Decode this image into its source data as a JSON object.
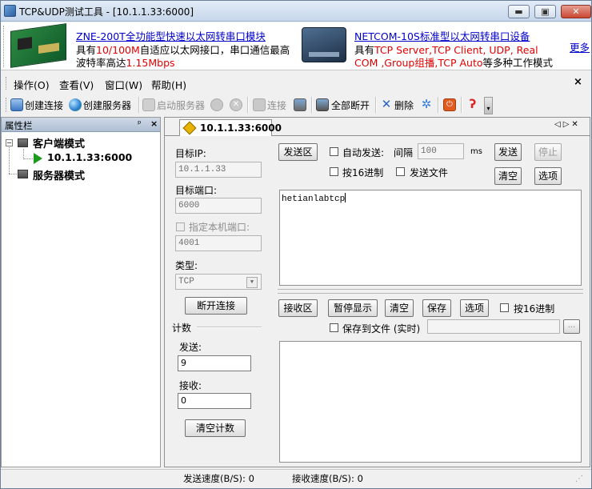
{
  "window": {
    "title": "TCP&UDP测试工具 - [10.1.1.33:6000]",
    "caption_min": "▬",
    "caption_max": "▣",
    "caption_close": "✕"
  },
  "banner": {
    "ad1": {
      "link": "ZNE-200T全功能型快速以太网转串口模块",
      "line2_a": "具有",
      "line2_red": "10/100M",
      "line2_b": "自适应以太网接口，串口通信最高",
      "line3_a": "波特率高达",
      "line3_red": "1.15Mbps"
    },
    "ad2": {
      "link": "NETCOM-10S标准型以太网转串口设备",
      "line2_a": "具有",
      "line2_red": "TCP Server,TCP Client, UDP, Real",
      "line3_red": "COM ,Group组播,TCP Auto",
      "line3_b": "等多种工作模式"
    },
    "more": "更多"
  },
  "menu": {
    "items": [
      "操作(O)",
      "查看(V)",
      "窗口(W)",
      "帮助(H)"
    ],
    "close": "×"
  },
  "toolbar": {
    "create_conn": "创建连接",
    "create_server": "创建服务器",
    "start_server": "启动服务器",
    "connect": "连接",
    "disconnect_all": "全部断开",
    "delete": "删除"
  },
  "sidebar": {
    "title": "属性栏",
    "pin": "ᵖ",
    "close": "×",
    "tree": {
      "client_mode": "客户端模式",
      "connection": "10.1.1.33:6000",
      "server_mode": "服务器模式"
    }
  },
  "tab": {
    "label": "10.1.1.33:6000",
    "nav": "◁▷✕"
  },
  "conn_panel": {
    "target_ip_label": "目标IP:",
    "target_ip_value": "10.1.1.33",
    "target_port_label": "目标端口:",
    "target_port_value": "6000",
    "local_port_label": "指定本机端口:",
    "local_port_value": "4001",
    "type_label": "类型:",
    "type_value": "TCP",
    "disconnect_btn": "断开连接",
    "count_label": "计数",
    "send_label": "发送:",
    "send_count": "9",
    "recv_label": "接收:",
    "recv_count": "0",
    "clear_count_btn": "清空计数"
  },
  "send_panel": {
    "area_btn": "发送区",
    "auto_send": "自动发送:",
    "interval_label": "间隔",
    "interval_value": "100",
    "interval_unit": "ms",
    "send_btn": "发送",
    "stop_btn": "停止",
    "hex_label": "按16进制",
    "send_file_label": "发送文件",
    "clear_btn": "清空",
    "options_btn": "选项",
    "content": "hetianlabtcp"
  },
  "recv_panel": {
    "area_btn": "接收区",
    "pause_btn": "暂停显示",
    "clear_btn": "清空",
    "save_btn": "保存",
    "options_btn": "选项",
    "hex_label": "按16进制",
    "save_file_label": "保存到文件 (实时)",
    "browse_btn": "..."
  },
  "statusbar": {
    "send_speed": "发送速度(B/S): 0",
    "recv_speed": "接收速度(B/S): 0",
    "grip": "⋰"
  },
  "colors": {
    "accent_red": "#e00000",
    "link_blue": "#0000cc",
    "play_green": "#1d9a1d"
  }
}
